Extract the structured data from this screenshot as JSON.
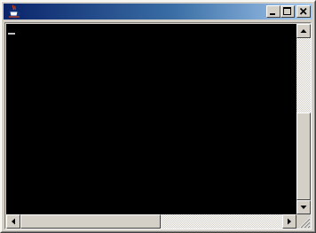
{
  "window": {
    "title": "",
    "icon": "java-cup-icon",
    "controls": [
      "minimize-icon",
      "maximize-icon",
      "close-icon"
    ]
  },
  "console": {
    "background": "#000000",
    "cursor_color": "#c0c0c0",
    "text": ""
  },
  "scrollbars": {
    "vertical": {
      "position": 0.47,
      "visible_fraction": 0.46
    },
    "horizontal": {
      "position": 0.0,
      "visible_fraction": 0.54
    }
  },
  "colors": {
    "titlebar_start": "#0a246a",
    "titlebar_end": "#a6caf0",
    "chrome": "#d4d0c8"
  }
}
